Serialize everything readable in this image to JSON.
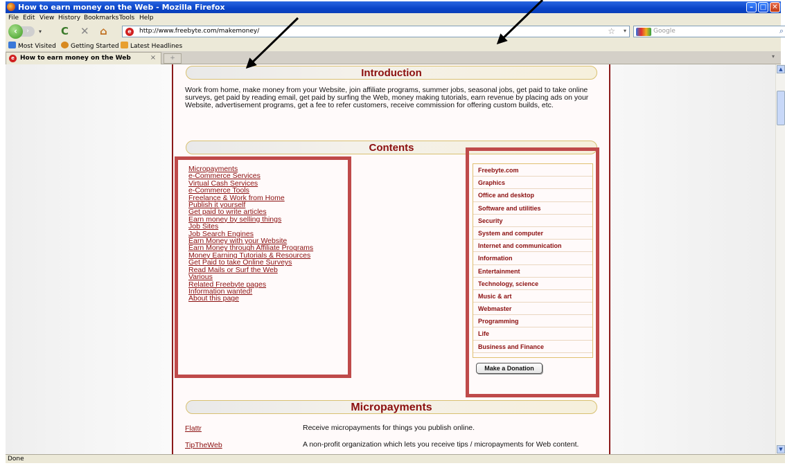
{
  "window": {
    "title": "How to earn money on the Web - Mozilla Firefox",
    "min": "–",
    "max": "□",
    "close": "✕"
  },
  "menu": [
    "File",
    "Edit",
    "View",
    "History",
    "Bookmarks",
    "Tools",
    "Help"
  ],
  "nav": {
    "back": "‹",
    "forward": "›",
    "reload": "C",
    "stop": "✕",
    "home": "⌂",
    "url": "http://www.freebyte.com/makemoney/",
    "star": "☆",
    "dropdown": "▾",
    "search_placeholder": "Google",
    "search_icon": "⌕"
  },
  "bookmarks": [
    {
      "label": "Most Visited",
      "color": "#3a78d8"
    },
    {
      "label": "Getting Started",
      "color": "#d88a20"
    },
    {
      "label": "Latest Headlines",
      "color": "#e8a030"
    }
  ],
  "tab": {
    "label": "How to earn money on the Web",
    "close": "×",
    "new_tab": "+"
  },
  "page": {
    "intro_title": "Introduction",
    "intro_text": "Work from home, make money from your Website, join affiliate programs, summer jobs, seasonal jobs, get paid to take online surveys, get paid by reading email, get paid by surfing the Web, money making tutorials, earn revenue by placing ads on your Website, advertisement programs, get a fee to refer customers, receive commission for offering custom builds, etc.",
    "contents_title": "Contents",
    "contents_links": [
      "Micropayments",
      "e-Commerce Services",
      "Virtual Cash Services",
      "e-Commerce Tools",
      "Freelance & Work from Home",
      "Publish it yourself",
      "Get paid to write articles",
      "Earn money by selling things",
      "Job Sites",
      "Job Search Engines",
      "Earn Money with your Website",
      "Earn Money through Affiliate Programs",
      "Money Earning Tutorials & Resources",
      "Get Paid to take Online Surveys",
      "Read Mails or Surf the Web",
      "Various",
      "Related Freebyte pages",
      "Information wanted!",
      "About this page"
    ],
    "categories": [
      "Freebyte.com",
      "Graphics",
      "Office and desktop",
      "Software and utilities",
      "Security",
      "System and computer",
      "Internet and communication",
      "Information",
      "Entertainment",
      "Technology, science",
      "Music & art",
      "Webmaster",
      "Programming",
      "Life",
      "Business and Finance"
    ],
    "donate_label": "Make a Donation",
    "micropayments_title": "Micropayments",
    "micropayments": [
      {
        "name": "Flattr",
        "desc": "Receive micropayments for things you publish online."
      },
      {
        "name": "TipTheWeb",
        "desc": "A non-profit organization which lets you receive tips / micropayments for Web content."
      }
    ]
  },
  "status": "Done",
  "colors": {
    "accent": "#8b0f0f",
    "highlight_box": "#bf4a4a"
  }
}
